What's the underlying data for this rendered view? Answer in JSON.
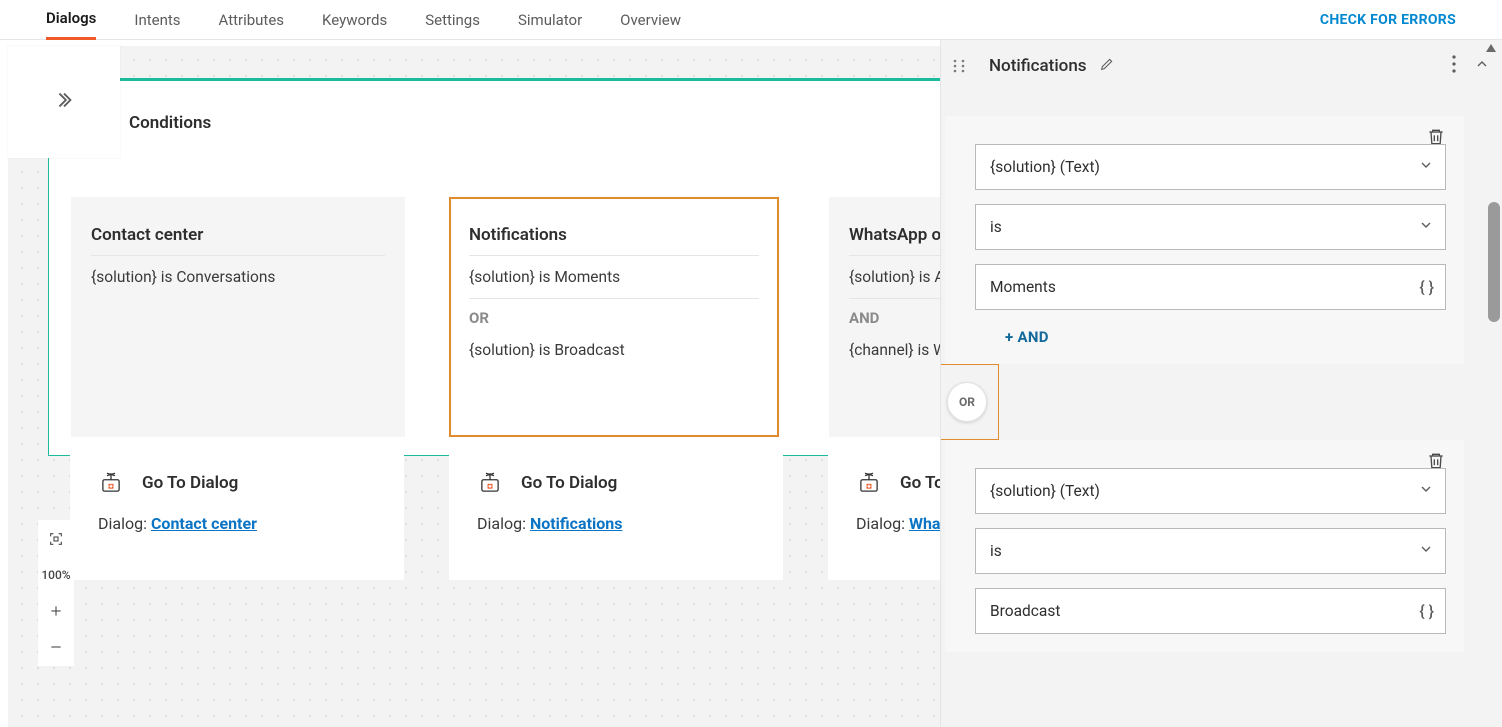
{
  "tabs": {
    "items": [
      "Dialogs",
      "Intents",
      "Attributes",
      "Keywords",
      "Settings",
      "Simulator",
      "Overview"
    ],
    "active_index": 0
  },
  "check_errors_label": "CHECK FOR ERRORS",
  "conditions": {
    "title": "Conditions",
    "cards": [
      {
        "title": "Contact center",
        "lines": [
          "{solution} is Conversations"
        ]
      },
      {
        "title": "Notifications",
        "lines": [
          "{solution} is Moments",
          "{solution} is Broadcast"
        ],
        "joiner": "OR",
        "selected": true
      },
      {
        "title": "WhatsApp o",
        "lines": [
          "{solution} is A",
          "{channel} is W"
        ],
        "joiner": "AND"
      }
    ]
  },
  "goto": {
    "heading": "Go To Dialog",
    "label": "Dialog:",
    "targets": [
      "Contact center",
      "Notifications",
      "Wha"
    ]
  },
  "zoom": {
    "percent": "100%"
  },
  "sidebar": {
    "title": "Notifications",
    "rules": [
      {
        "attribute": "{solution} (Text)",
        "operator": "is",
        "value": "Moments"
      },
      {
        "attribute": "{solution} (Text)",
        "operator": "is",
        "value": "Broadcast"
      }
    ],
    "add_and_label": "+ AND",
    "or_label": "OR"
  }
}
